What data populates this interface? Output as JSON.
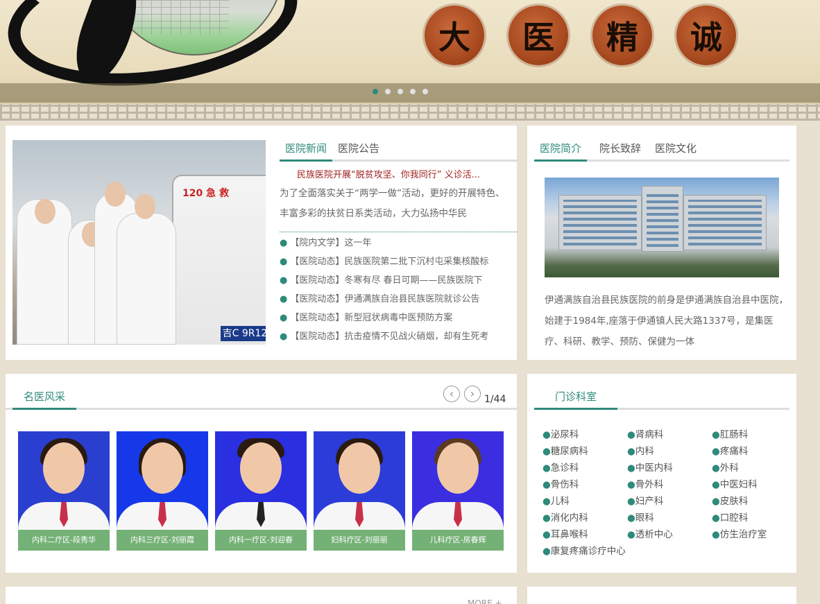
{
  "banner": {
    "seal_chars": [
      "大",
      "医",
      "精",
      "诚"
    ],
    "slider_dots": 5,
    "active_dot": 0
  },
  "news_panel": {
    "tabs": [
      "医院新闻",
      "医院公告"
    ],
    "active_tab": 0,
    "headline": "民族医院开展“脱贫攻坚、你我同行” 义诊活...",
    "summary": "为了全面落实关于“两学一做”活动，更好的开展特色、丰富多彩的扶贫日系类活动，大力弘扬中华民",
    "photo": {
      "vehicle_text": "120 急 救",
      "plate": "吉C 9R12"
    },
    "items": [
      "【院内文学】这一年",
      "【医院动态】民族医院第二批下沉村屯采集核酸标",
      "【医院动态】冬寒有尽 春日可期——民族医院下",
      "【医院动态】伊通满族自治县民族医院就诊公告",
      "【医院动态】新型冠状病毒中医预防方案",
      "【医院动态】抗击疫情不见战火硝烟，却有生死考"
    ]
  },
  "intro_panel": {
    "tabs": [
      "医院简介",
      "院长致辞",
      "医院文化"
    ],
    "active_tab": 0,
    "text": "伊通满族自治县民族医院的前身是伊通满族自治县中医院，始建于1984年,座落于伊通镇人民大路1337号，是集医疗、科研、教学、预防、保健为一体"
  },
  "doctors_panel": {
    "title": "名医风采",
    "prev_icon": "‹",
    "next_icon": "›",
    "pager": "1/44",
    "doctors": [
      "内科二疗区-段秀华",
      "内科三疗区-刘丽霞",
      "内科一疗区-刘迎春",
      "妇科疗区-刘丽丽",
      "儿科疗区-房春辉"
    ]
  },
  "dept_panel": {
    "title": "门诊科室",
    "departments": [
      "泌尿科",
      "肾病科",
      "肛肠科",
      "糖尿病科",
      "内科",
      "疼痛科",
      "急诊科",
      "中医内科",
      "外科",
      "骨伤科",
      "骨外科",
      "中医妇科",
      "儿科",
      "妇产科",
      "皮肤科",
      "消化内科",
      "眼科",
      "口腔科",
      "耳鼻喉科",
      "透析中心",
      "仿生治疗室",
      "康复疼痛诊疗中心"
    ]
  },
  "bottom": {
    "more": "MORE +"
  },
  "colors": {
    "accent": "#2e8a7a",
    "headline": "#a02020",
    "seal": "#a94a20"
  }
}
